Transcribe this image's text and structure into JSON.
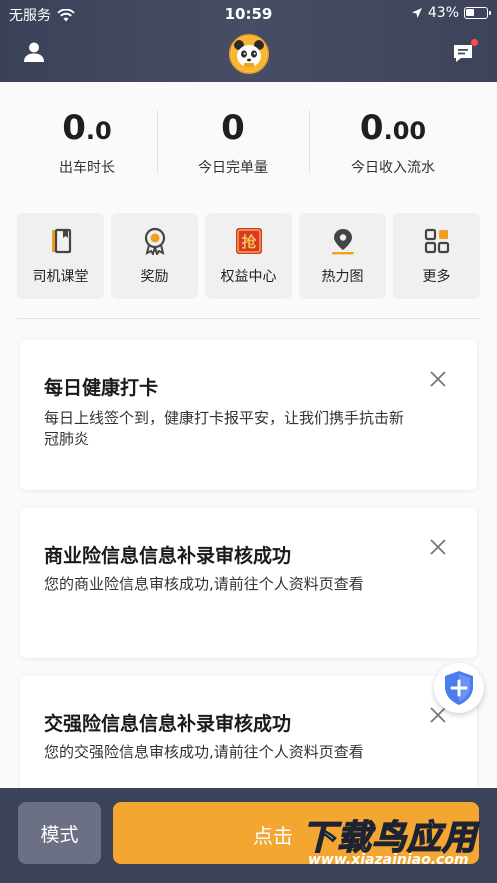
{
  "status_bar": {
    "carrier": "无服务",
    "time": "10:59",
    "battery_percent": "43%",
    "battery_level": 0.43
  },
  "header": {
    "left_icon": "user-icon",
    "center_logo": "panda-logo",
    "right_icon": "message-icon",
    "has_notification": true
  },
  "stats": [
    {
      "value_int": "0",
      "value_dec": ".0",
      "label": "出车时长"
    },
    {
      "value_int": "0",
      "value_dec": "",
      "label": "今日完单量"
    },
    {
      "value_int": "0",
      "value_dec": ".00",
      "label": "今日收入流水"
    }
  ],
  "tiles": [
    {
      "label": "司机课堂",
      "icon": "book-icon"
    },
    {
      "label": "奖励",
      "icon": "medal-icon"
    },
    {
      "label": "权益中心",
      "icon": "grab-red-packet-icon",
      "icon_text": "抢"
    },
    {
      "label": "热力图",
      "icon": "location-pin-icon"
    },
    {
      "label": "更多",
      "icon": "grid-icon"
    }
  ],
  "cards": [
    {
      "title": "每日健康打卡",
      "desc": "每日上线签个到，健康打卡报平安，让我们携手抗击新冠肺炎"
    },
    {
      "title": "商业险信息信息补录审核成功",
      "desc": "您的商业险信息审核成功,请前往个人资料页查看"
    },
    {
      "title": "交强险信息信息补录审核成功",
      "desc": "您的交强险信息审核成功,请前往个人资料页查看"
    }
  ],
  "fab": {
    "icon": "shield-plus-icon"
  },
  "bottom_bar": {
    "mode_label": "模式",
    "go_label": "点击"
  },
  "watermark": {
    "main": "下载鸟应用",
    "url": "www.xiazainiao.com"
  },
  "colors": {
    "header_bg": "#3b4157",
    "accent_orange": "#f3a632",
    "mode_btn": "#6b7084",
    "tile_bg": "#f0f0f0",
    "fab_blue": "#4d7cf0"
  }
}
